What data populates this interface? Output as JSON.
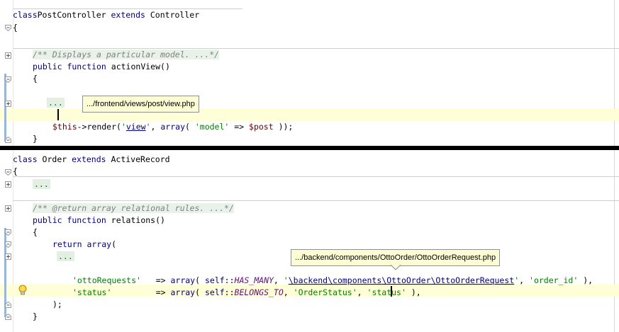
{
  "editor_top": {
    "lines": [
      {
        "id": "class-decl",
        "tokens": [
          [
            "kw",
            "class"
          ],
          [
            "",
            "PostController "
          ],
          [
            "kw",
            "extends"
          ],
          [
            "",
            " Controller"
          ]
        ]
      },
      {
        "id": "open-brace",
        "tokens": [
          [
            "",
            "{"
          ]
        ]
      },
      {
        "id": "doc-comment",
        "tokens": [
          [
            "cm fold-bg",
            "/** Displays a particular model. ...*/"
          ]
        ]
      },
      {
        "id": "func-decl",
        "tokens": [
          [
            "kw",
            "public function"
          ],
          [
            "",
            " actionView()"
          ]
        ]
      },
      {
        "id": "func-open",
        "tokens": [
          [
            "",
            "{"
          ]
        ]
      },
      {
        "id": "folded",
        "tokens": [
          [
            "fold-text",
            "..."
          ]
        ]
      },
      {
        "id": "render-call",
        "tokens": [
          [
            "var",
            "$this"
          ],
          [
            "",
            "->render("
          ],
          [
            "str",
            "'"
          ],
          [
            "link",
            "view"
          ],
          [
            "str",
            "'"
          ],
          [
            "",
            ", "
          ],
          [
            "kw",
            "array"
          ],
          [
            "",
            "( "
          ],
          [
            "str",
            "'model'"
          ],
          [
            "",
            " => "
          ],
          [
            "var",
            "$post"
          ],
          [
            "",
            " ));"
          ]
        ]
      },
      {
        "id": "func-close",
        "tokens": [
          [
            "",
            "}"
          ]
        ]
      }
    ],
    "tooltip": ".../frontend/views/post/view.php"
  },
  "editor_bottom": {
    "lines": [
      {
        "id": "class-decl",
        "tokens": [
          [
            "kw",
            "class"
          ],
          [
            "",
            " Order "
          ],
          [
            "kw",
            "extends"
          ],
          [
            "",
            " ActiveRecord"
          ]
        ]
      },
      {
        "id": "open-brace",
        "tokens": [
          [
            "",
            "{"
          ]
        ]
      },
      {
        "id": "folded-body",
        "tokens": [
          [
            "fold-text",
            "..."
          ]
        ]
      },
      {
        "id": "doc-comment",
        "tokens": [
          [
            "cm fold-bg",
            "/** @return array relational rules. ...*/"
          ]
        ]
      },
      {
        "id": "func-decl",
        "tokens": [
          [
            "kw",
            "public function"
          ],
          [
            "",
            " relations()"
          ]
        ]
      },
      {
        "id": "func-open",
        "tokens": [
          [
            "",
            "{"
          ]
        ]
      },
      {
        "id": "return-line",
        "tokens": [
          [
            "kw",
            "return array"
          ],
          [
            "",
            "("
          ]
        ]
      },
      {
        "id": "folded-items",
        "tokens": [
          [
            "fold-text",
            "..."
          ]
        ]
      },
      {
        "id": "otto-line",
        "tokens": [
          [
            "str",
            "'ottoRequests'"
          ],
          [
            "",
            "   => "
          ],
          [
            "kw",
            "array"
          ],
          [
            "",
            "( "
          ],
          [
            "kw",
            "self"
          ],
          [
            "",
            "::"
          ],
          [
            "const",
            "HAS_MANY"
          ],
          [
            "",
            ", "
          ],
          [
            "str",
            "'"
          ],
          [
            "link",
            "\\backend\\components\\OttoOrder\\OttoOrderRequest"
          ],
          [
            "str",
            "'"
          ],
          [
            "",
            ", "
          ],
          [
            "str",
            "'order_id'"
          ],
          [
            "",
            " ),"
          ]
        ]
      },
      {
        "id": "status-line",
        "tokens": [
          [
            "str",
            "'status'"
          ],
          [
            "",
            "         => "
          ],
          [
            "kw",
            "array"
          ],
          [
            "",
            "( "
          ],
          [
            "kw",
            "self"
          ],
          [
            "",
            "::"
          ],
          [
            "const",
            "BELONGS_TO"
          ],
          [
            "",
            ", "
          ],
          [
            "str",
            "'OrderStatus'"
          ],
          [
            "",
            ", "
          ],
          [
            "str",
            "'status'"
          ],
          [
            "",
            " ),"
          ]
        ]
      },
      {
        "id": "array-close",
        "tokens": [
          [
            "",
            ");"
          ]
        ]
      },
      {
        "id": "func-close",
        "tokens": [
          [
            "",
            "}"
          ]
        ]
      }
    ],
    "tooltip": ".../backend/components/OttoOrder/OttoOrderRequest.php"
  },
  "icons": {
    "fold_expand": "fold-expand-icon",
    "fold_collapse": "fold-collapse-icon",
    "intention": "lightbulb-icon"
  },
  "colors": {
    "keyword": "#000080",
    "string": "#008000",
    "comment": "#808080",
    "variable": "#660000",
    "constant": "#660e7a",
    "caret_row": "#ffffd7",
    "tooltip_bg": "#fdfdd5"
  }
}
